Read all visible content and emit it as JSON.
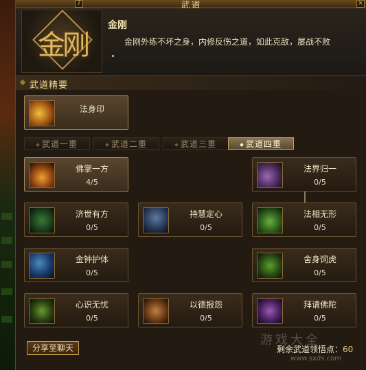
{
  "window": {
    "title": "武道",
    "help_label": "?",
    "close_label": "×"
  },
  "header": {
    "emblem_glyph": "金刚",
    "skill_name": "金刚",
    "skill_desc": "金刚外练不坏之身，内修反伤之道，如此克敌，屡战不败"
  },
  "section": {
    "title": "武道精要"
  },
  "essence": {
    "name": "法身印",
    "icon": "palm-seal-icon"
  },
  "tabs": [
    {
      "label": "武道一重"
    },
    {
      "label": "武道二重"
    },
    {
      "label": "武道三重"
    },
    {
      "label": "武道四重"
    }
  ],
  "skills": [
    {
      "name": "佛掌一方",
      "level": "4/5",
      "icon": "buddha-palm-icon"
    },
    {
      "name": "法界归一",
      "level": "0/5",
      "icon": "dharma-realm-icon"
    },
    {
      "name": "济世有方",
      "level": "0/5",
      "icon": "swastika-icon"
    },
    {
      "name": "持慧定心",
      "level": "0/5",
      "icon": "meditation-icon"
    },
    {
      "name": "法相无形",
      "level": "0/5",
      "icon": "dharma-form-icon"
    },
    {
      "name": "金钟护体",
      "level": "0/5",
      "icon": "golden-bell-icon"
    },
    {
      "name": "舍身饲虎",
      "level": "0/5",
      "icon": "tiger-icon"
    },
    {
      "name": "心识无忧",
      "level": "0/5",
      "icon": "mind-icon"
    },
    {
      "name": "以德报怨",
      "level": "0/5",
      "icon": "virtue-icon"
    },
    {
      "name": "拜请佛陀",
      "level": "0/5",
      "icon": "buddha-icon"
    }
  ],
  "footer": {
    "share_label": "分享至聊天",
    "remain_label": "剩余武道领悟点：",
    "remain_value": "60",
    "watermark": "游戏大全",
    "watermark_url": "www.sxds.com"
  },
  "colors": {
    "accent": "#f0d890",
    "active_tab": "#8a7450"
  }
}
